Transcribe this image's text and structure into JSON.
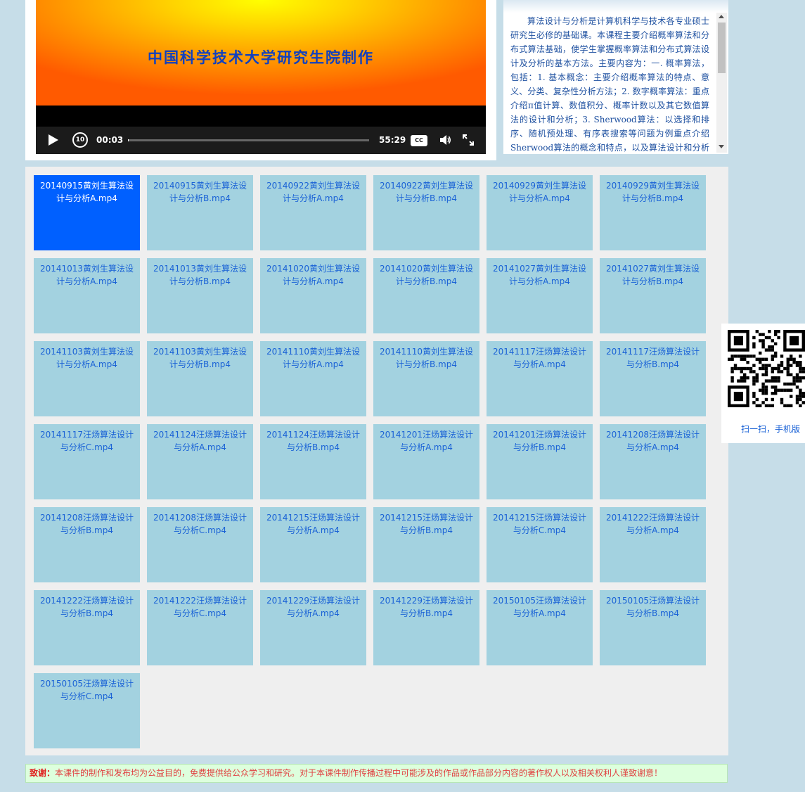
{
  "player": {
    "video_caption": "中国科学技术大学研究生院制作",
    "current_time": "00:03",
    "total_time": "55:29",
    "progress": 0.001,
    "replay_label": "10",
    "cc_label": "CC"
  },
  "description": {
    "text": "算法设计与分析是计算机科学与技术各专业硕士研究生必修的基础课。本课程主要介绍概率算法和分布式算法基础，使学生掌握概率算法和分布式算法设计及分析的基本方法。主要内容为：一. 概率算法，包括：1. 基本概念：主要介绍概率算法的特点、意义、分类、复杂性分析方法；2. 数字概率算法：重点介绍π值计算、数值积分、概率计数以及其它数值算法的设计和分析；3. Sherwood算法：以选择和排序、随机预处理、有序表搜索等问题为例重点介绍Sherwood算法的概念和特点，以及算法设计和分析的"
  },
  "episodes": [
    {
      "label": "20140915黄刘生算法设计与分析A.mp4",
      "active": true
    },
    {
      "label": "20140915黄刘生算法设计与分析B.mp4"
    },
    {
      "label": "20140922黄刘生算法设计与分析A.mp4"
    },
    {
      "label": "20140922黄刘生算法设计与分析B.mp4"
    },
    {
      "label": "20140929黄刘生算法设计与分析A.mp4"
    },
    {
      "label": "20140929黄刘生算法设计与分析B.mp4"
    },
    {
      "label": "20141013黄刘生算法设计与分析A.mp4"
    },
    {
      "label": "20141013黄刘生算法设计与分析B.mp4"
    },
    {
      "label": "20141020黄刘生算法设计与分析A.mp4"
    },
    {
      "label": "20141020黄刘生算法设计与分析B.mp4"
    },
    {
      "label": "20141027黄刘生算法设计与分析A.mp4"
    },
    {
      "label": "20141027黄刘生算法设计与分析B.mp4"
    },
    {
      "label": "20141103黄刘生算法设计与分析A.mp4"
    },
    {
      "label": "20141103黄刘生算法设计与分析B.mp4"
    },
    {
      "label": "20141110黄刘生算法设计与分析A.mp4"
    },
    {
      "label": "20141110黄刘生算法设计与分析B.mp4"
    },
    {
      "label": "20141117汪炀算法设计与分析A.mp4"
    },
    {
      "label": "20141117汪炀算法设计与分析B.mp4"
    },
    {
      "label": "20141117汪炀算法设计与分析C.mp4"
    },
    {
      "label": "20141124汪炀算法设计与分析A.mp4"
    },
    {
      "label": "20141124汪炀算法设计与分析B.mp4"
    },
    {
      "label": "20141201汪炀算法设计与分析A.mp4"
    },
    {
      "label": "20141201汪炀算法设计与分析B.mp4"
    },
    {
      "label": "20141208汪炀算法设计与分析A.mp4"
    },
    {
      "label": "20141208汪炀算法设计与分析B.mp4"
    },
    {
      "label": "20141208汪炀算法设计与分析C.mp4"
    },
    {
      "label": "20141215汪炀算法设计与分析A.mp4"
    },
    {
      "label": "20141215汪炀算法设计与分析B.mp4"
    },
    {
      "label": "20141215汪炀算法设计与分析C.mp4"
    },
    {
      "label": "20141222汪炀算法设计与分析A.mp4"
    },
    {
      "label": "20141222汪炀算法设计与分析B.mp4"
    },
    {
      "label": "20141222汪炀算法设计与分析C.mp4"
    },
    {
      "label": "20141229汪炀算法设计与分析A.mp4"
    },
    {
      "label": "20141229汪炀算法设计与分析B.mp4"
    },
    {
      "label": "20150105汪炀算法设计与分析A.mp4"
    },
    {
      "label": "20150105汪炀算法设计与分析B.mp4"
    },
    {
      "label": "20150105汪炀算法设计与分析C.mp4"
    }
  ],
  "notice": {
    "title": "致谢：",
    "text": "本课件的制作和发布均为公益目的，免费提供给公众学习和研究。对于本课件制作传播过程中可能涉及的作品或作品部分内容的著作权人以及相关权利人谨致谢意！"
  },
  "qr": {
    "label": "扫一扫，手机版"
  },
  "colors": {
    "tile": "#a3d2e0",
    "tile_active": "#0060ff",
    "tile_text": "#1a62d6",
    "page_bg": "#c6dde8",
    "notice_bg": "#ddffdd",
    "notice_text": "#e04040"
  }
}
